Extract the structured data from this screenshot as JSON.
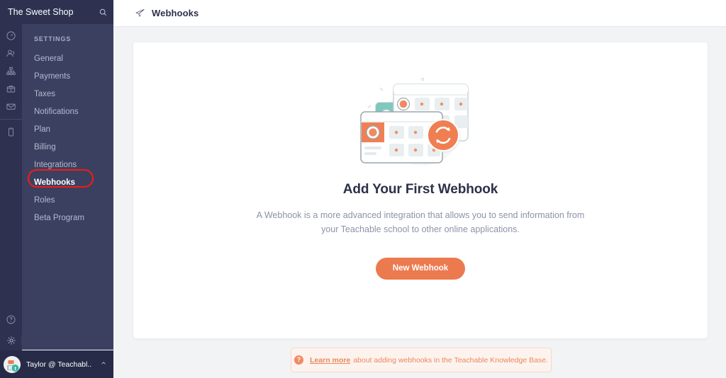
{
  "brand": {
    "name": "The Sweet Shop",
    "search_icon": "search-icon"
  },
  "rail": {
    "items": [
      {
        "icon": "dashboard-gauge-icon",
        "label": "Dashboard"
      },
      {
        "icon": "students-users-icon",
        "label": "Users"
      },
      {
        "icon": "site-structure-icon",
        "label": "Site"
      },
      {
        "icon": "sales-box-icon",
        "label": "Sales"
      },
      {
        "icon": "email-envelope-icon",
        "label": "Emails"
      },
      {
        "icon": "mobile-device-icon",
        "label": "Mobile"
      }
    ],
    "bottom_items": [
      {
        "icon": "help-question-icon",
        "label": "Help",
        "active": false
      },
      {
        "icon": "settings-gear-icon",
        "label": "Settings",
        "active": true
      }
    ]
  },
  "sidebar": {
    "section_title": "SETTINGS",
    "items": [
      {
        "label": "General",
        "active": false
      },
      {
        "label": "Payments",
        "active": false
      },
      {
        "label": "Taxes",
        "active": false
      },
      {
        "label": "Notifications",
        "active": false
      },
      {
        "label": "Plan",
        "active": false
      },
      {
        "label": "Billing",
        "active": false
      },
      {
        "label": "Integrations",
        "active": false
      },
      {
        "label": "Webhooks",
        "active": true
      },
      {
        "label": "Roles",
        "active": false
      },
      {
        "label": "Beta Program",
        "active": false
      }
    ]
  },
  "user": {
    "name": "Taylor @ Teachabl..",
    "chevron": "^",
    "avatar_icon": "user-avatar"
  },
  "topbar": {
    "icon": "paper-plane-icon",
    "title": "Webhooks"
  },
  "empty_state": {
    "illustration": "webhook-sync-cards-illustration",
    "headline": "Add Your First Webhook",
    "description": "A Webhook is a more advanced integration that allows you to send information from your Teachable school to other online applications.",
    "cta_label": "New Webhook"
  },
  "banner": {
    "icon": "question-mark-circle-icon",
    "link_text": "Learn more",
    "text": "about adding webhooks in the Teachable Knowledge Base."
  },
  "colors": {
    "rail_bg": "#2e3250",
    "subpanel_bg": "#3b4061",
    "userbar_bg": "#272b47",
    "accent_orange": "#ec7a4f",
    "page_bg": "#f2f3f5",
    "annotation_red": "#f51b10",
    "heading": "#2c3049",
    "muted_text": "#8d93a8"
  }
}
